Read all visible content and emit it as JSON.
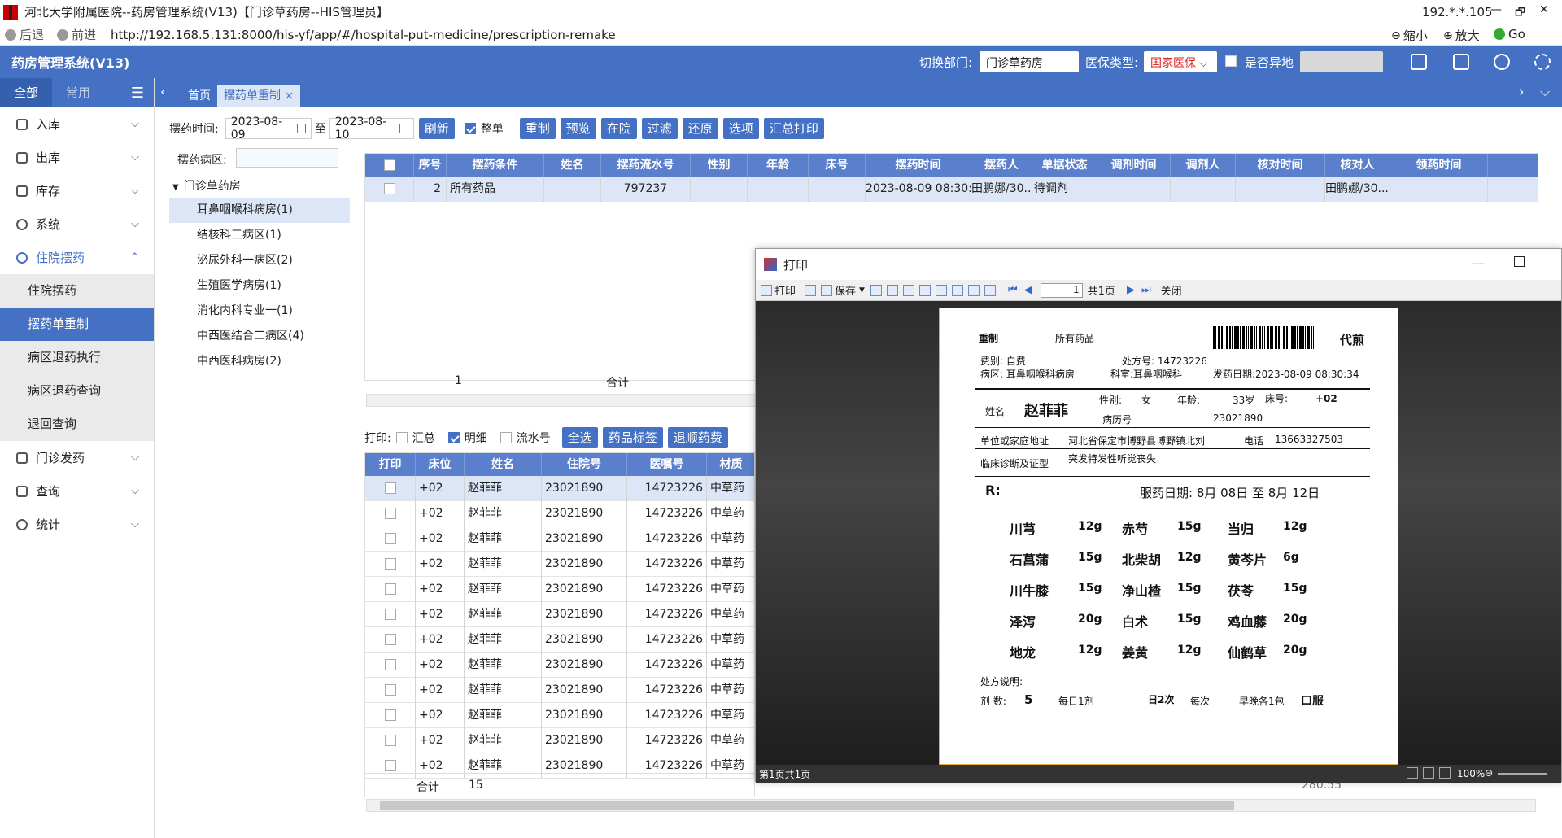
{
  "window": {
    "title": "河北大学附属医院--药房管理系统(V13)【门诊草药房--HIS管理员】",
    "ip": "192.*.*.105",
    "min": "—",
    "restore": "🗗",
    "close": "✕"
  },
  "browser": {
    "back": "后退",
    "forward": "前进",
    "url": "http://192.168.5.131:8000/his-yf/app/#/hospital-put-medicine/prescription-remake",
    "zoom_out": "缩小",
    "zoom_in": "放大",
    "go": "Go"
  },
  "header": {
    "brand": "药房管理系统(V13)",
    "dept_label": "切换部门:",
    "dept_value": "门诊草药房",
    "ins_label": "医保类型:",
    "ins_value": "国家医保",
    "remote_label": "是否异地"
  },
  "sidebar": {
    "tab_all": "全部",
    "tab_common": "常用",
    "items": [
      {
        "label": "入库"
      },
      {
        "label": "出库"
      },
      {
        "label": "库存"
      },
      {
        "label": "系统"
      },
      {
        "label": "住院摆药"
      }
    ],
    "subitems": [
      "住院摆药",
      "摆药单重制",
      "病区退药执行",
      "病区退药查询",
      "退回查询"
    ],
    "items2": [
      {
        "label": "门诊发药"
      },
      {
        "label": "查询"
      },
      {
        "label": "统计"
      }
    ]
  },
  "tabs": {
    "home": "首页",
    "current": "摆药单重制",
    "close": "×"
  },
  "toolbar": {
    "time_label": "摆药时间:",
    "date_from": "2023-08-09",
    "to": "至",
    "date_to": "2023-08-10",
    "refresh": "刷新",
    "whole": "整单",
    "remake": "重制",
    "preview": "预览",
    "inhosp": "在院",
    "filter": "过滤",
    "restore": "还原",
    "options": "选项",
    "sum_print": "汇总打印"
  },
  "ward": {
    "label": "摆药病区:",
    "root": "门诊草药房",
    "nodes": [
      "耳鼻咽喉科病房(1)",
      "结核科三病区(1)",
      "泌尿外科一病区(2)",
      "生殖医学病房(1)",
      "消化内科专业一(1)",
      "中西医结合二病区(4)",
      "中西医科病房(2)"
    ]
  },
  "grid1": {
    "headers": [
      "序号",
      "摆药条件",
      "姓名",
      "摆药流水号",
      "性别",
      "年龄",
      "床号",
      "摆药时间",
      "摆药人",
      "单据状态",
      "调剂时间",
      "调剂人",
      "核对时间",
      "核对人",
      "领药时间"
    ],
    "row": {
      "no": "2",
      "cond": "所有药品",
      "serial": "797237",
      "time": "2023-08-09 08:30:...",
      "person": "田鹏娜/30...",
      "status": "待调剂",
      "checker": "田鹏娜/30..."
    },
    "sum_count": "1",
    "sum_label": "合计"
  },
  "bottom": {
    "print_label": "打印:",
    "summary": "汇总",
    "detail": "明细",
    "serial": "流水号",
    "select_all": "全选",
    "drug_label": "药品标签",
    "return_fee": "退顺药费",
    "headers": [
      "打印",
      "床位",
      "姓名",
      "住院号",
      "医嘱号",
      "材质"
    ],
    "row": {
      "bed": "+02",
      "name": "赵菲菲",
      "inp": "23021890",
      "order": "14723226",
      "mat": "中草药"
    },
    "sum_label": "合计",
    "sum_count": "15",
    "sum_amount": "280.55"
  },
  "print": {
    "title": "打印",
    "print": "打印",
    "save": "保存",
    "page": "1",
    "total": "共1页",
    "close": "关闭",
    "status": "第1页共1页",
    "zoom": "100%",
    "paper": {
      "remake": "重制",
      "all": "所有药品",
      "decoct": "代煎",
      "fee": "费别:  自费",
      "rx_no": "处方号: 14723226",
      "ward": "病区: 耳鼻咽喉科病房",
      "dept": "科室:耳鼻咽喉科",
      "date": "发药日期:2023-08-09  08:30:34",
      "name_label": "姓名",
      "name": "赵菲菲",
      "sex_label": "性别:",
      "sex": "女",
      "age_label": "年龄:",
      "age": "33岁",
      "bed_label": "床号:",
      "bed": "+02",
      "rec_label": "病历号",
      "rec": "23021890",
      "addr_label": "单位或家庭地址",
      "addr": "河北省保定市博野县博野镇北刘",
      "tel_label": "电话",
      "tel": "13663327503",
      "diag_label": "临床诊断及证型",
      "diag": "突发特发性听觉丧失",
      "r": "R:",
      "take": "服药日期:  8月  08日  至  8月  12日",
      "herbs": [
        [
          "川芎",
          "12g",
          "赤芍",
          "15g",
          "当归",
          "12g"
        ],
        [
          "石菖蒲",
          "15g",
          "北柴胡",
          "12g",
          "黄芩片",
          "6g"
        ],
        [
          "川牛膝",
          "15g",
          "净山楂",
          "15g",
          "茯苓",
          "15g"
        ],
        [
          "泽泻",
          "20g",
          "白术",
          "15g",
          "鸡血藤",
          "20g"
        ],
        [
          "地龙",
          "12g",
          "姜黄",
          "12g",
          "仙鹤草",
          "20g"
        ]
      ],
      "note_label": "处方说明:",
      "dose_label": "剂  数:",
      "dose": "5",
      "daily": "每日1剂",
      "twice": "日2次",
      "per": "每次",
      "morning": "早晚各1包",
      "oral": "口服"
    }
  }
}
